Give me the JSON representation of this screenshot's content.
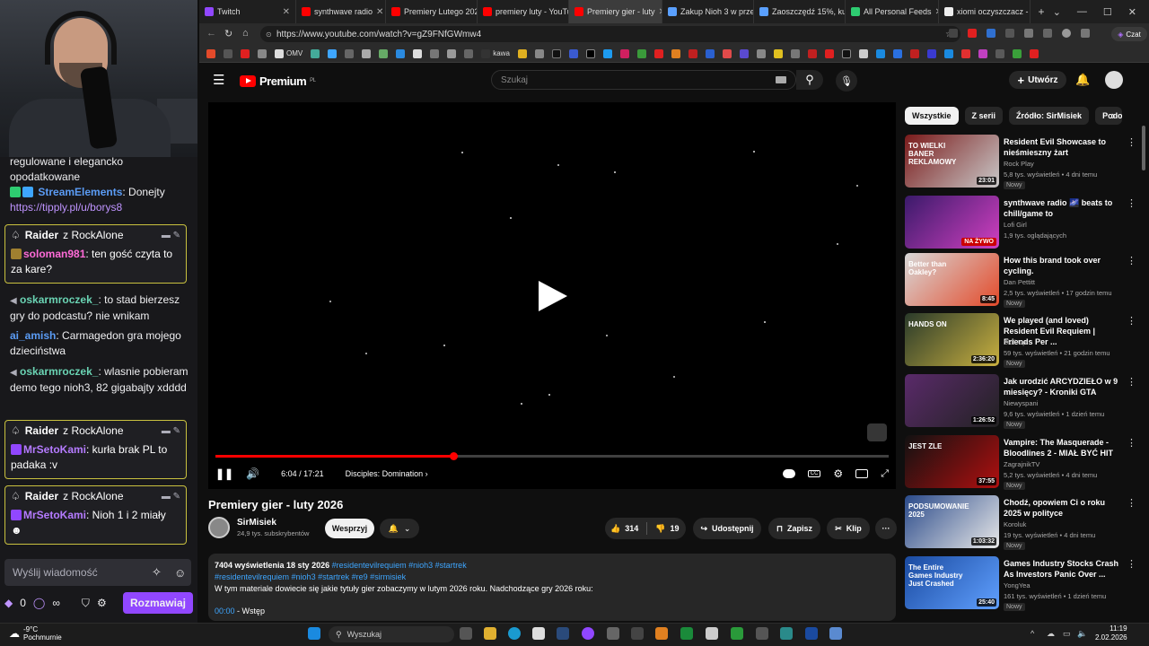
{
  "chat": {
    "top_partial": "regulowane i elegancko opodatkowane",
    "m1_user": "StreamElements",
    "m1_text": ": Donejty",
    "m1_link": "https://tipply.pl/u/borys8",
    "raid1_name": "Raider",
    "raid1_from": "z RockAlone",
    "raid1_user": "soloman981",
    "raid1_text": ": ten gość czyta to za kare?",
    "m2_user": "oskarmroczek_",
    "m2_text": ": to stad bierzesz gry do podcastu? nie wnikam",
    "m3_user": "ai_amish",
    "m3_text": ": Carmagedon gra mojego dzieciństwa",
    "m4_user": "oskarmroczek_",
    "m4_text": ": wlasnie pobieram demo tego nioh3, 82 gigabajty xdddd",
    "raid2_name": "Raider",
    "raid2_from": "z RockAlone",
    "raid2_user": "MrSetoKami",
    "raid2_text": ": kurła brak PL to padaka :v",
    "raid3_name": "Raider",
    "raid3_from": "z RockAlone",
    "raid3_user": "MrSetoKami",
    "raid3_text": ": Nioh 1 i 2 miały",
    "input_placeholder": "Wyślij wiadomość",
    "points": "0",
    "send_label": "Rozmawiaj"
  },
  "browser": {
    "tabs": [
      {
        "label": "Twitch",
        "color": "#9147ff"
      },
      {
        "label": "synthwave radio",
        "color": "#ff0000"
      },
      {
        "label": "Premiery Lutego 2026",
        "color": "#ff0000"
      },
      {
        "label": "premiery luty - YouTube",
        "color": "#ff0000"
      },
      {
        "label": "Premiery gier - luty",
        "color": "#ff0000"
      },
      {
        "label": "Zakup Nioh 3 w przed",
        "color": "#5aa0ff"
      },
      {
        "label": "Zaoszczędź 15%, kup",
        "color": "#5aa0ff"
      },
      {
        "label": "All Personal Feeds",
        "color": "#2ecc71"
      },
      {
        "label": "xiomi oczyszczacz - S",
        "color": "#eeeeee"
      }
    ],
    "url": "https://www.youtube.com/watch?v=gZ9FNfGWmw4",
    "bookmark_label": "kawa",
    "bookmark_label2": "OMV",
    "profile_label": "Czat"
  },
  "yt": {
    "logo": "Premium",
    "logo_region": "PL",
    "search_placeholder": "Szukaj",
    "create_label": "Utwórz",
    "time": "6:04 / 17:21",
    "chapter": "Disciples: Domination",
    "progress_fraction": 0.35,
    "title": "Premiery gier - luty 2026",
    "channel": "SirMisiek",
    "subs": "24,9 tys. subskrybentów",
    "support_label": "Wesprzyj",
    "likes": "314",
    "dislikes": "19",
    "share_label": "Udostępnij",
    "save_label": "Zapisz",
    "clip_label": "Klip",
    "desc_views": "7404 wyświetlenia  18 sty 2026",
    "desc_tags1": "#residentevilrequiem #nioh3 #startrek",
    "desc_tags2": "#residentevilrequiem #nioh3 #startrek #re9 #sirmisiek",
    "desc_text": "W tym materiale dowiecie się jakie tytuły gier zobaczymy w lutym 2026 roku. Nadchodzące gry 2026 roku:",
    "desc_ts": "00:00",
    "desc_ts_label": " - Wstęp",
    "chips": [
      "Wszystkie",
      "Z serii",
      "Źródło: SirMisiek",
      "Podo"
    ],
    "recs": [
      {
        "title": "Resident Evil Showcase to nieśmieszny żart",
        "channel": "Rock Play",
        "meta": "5,8 tys. wyświetleń • 4 dni temu",
        "badge": "Nowy",
        "dur": "23:01",
        "c1": "#7a1a1a",
        "c2": "#c9c9c9",
        "thumbtext": "TO WIELKI BANER REKLAMOWY"
      },
      {
        "title": "synthwave radio 🌌 beats to chill/game to",
        "channel": "Lofi Girl",
        "meta": "1,9 tys. oglądających",
        "badge": "",
        "dur": "NA ŻYWO",
        "c1": "#3a1a6a",
        "c2": "#d040c0",
        "thumbtext": ""
      },
      {
        "title": "How this brand took over cycling.",
        "channel": "Dan Pettitt",
        "meta": "2,5 tys. wyświetleń • 17 godzin temu",
        "badge": "Nowy",
        "dur": "8:45",
        "c1": "#d8d8d8",
        "c2": "#e34a2a",
        "thumbtext": "Better than Oakley?"
      },
      {
        "title": "We played (and loved) Resident Evil Requiem | Friends Per ...",
        "channel": "Skill Up",
        "meta": "59 tys. wyświetleń • 21 godzin temu",
        "badge": "Nowy",
        "dur": "2:36:20",
        "c1": "#2a3a2a",
        "c2": "#c9b040",
        "thumbtext": "HANDS ON"
      },
      {
        "title": "Jak urodzić ARCYDZIEŁO w 9 miesięcy? - Kroniki GTA",
        "channel": "Niewyspani",
        "meta": "9,6 tys. wyświetleń • 1 dzień temu",
        "badge": "Nowy",
        "dur": "1:26:52",
        "c1": "#5a2a6a",
        "c2": "#222222",
        "thumbtext": ""
      },
      {
        "title": "Vampire: The Masquerade - Bloodlines 2 - MIAŁ BYĆ HIT",
        "channel": "ZagrajnikTV",
        "meta": "5,2 tys. wyświetleń • 4 dni temu",
        "badge": "Nowy",
        "dur": "37:55",
        "c1": "#111111",
        "c2": "#b01010",
        "thumbtext": "JEST ZLE"
      },
      {
        "title": "Chodź, opowiem Ci o roku 2025 w polityce",
        "channel": "Koroluk",
        "meta": "19 tys. wyświetleń • 4 dni temu",
        "badge": "Nowy",
        "dur": "1:03:32",
        "c1": "#2a4a8a",
        "c2": "#e8e8e8",
        "thumbtext": "PODSUMOWANIE 2025"
      },
      {
        "title": "Games Industry Stocks Crash As Investors Panic Over ...",
        "channel": "YongYea",
        "meta": "161 tys. wyświetleń • 1 dzień temu",
        "badge": "Nowy",
        "dur": "25:40",
        "c1": "#1a4aa0",
        "c2": "#60a0ff",
        "thumbtext": "The Entire Games Industry Just Crashed"
      }
    ]
  },
  "taskbar": {
    "temp": "-9°C",
    "weather": "Pochmurnie",
    "search": "Wyszukaj",
    "time": "11:19",
    "date": "2.02.2026"
  }
}
